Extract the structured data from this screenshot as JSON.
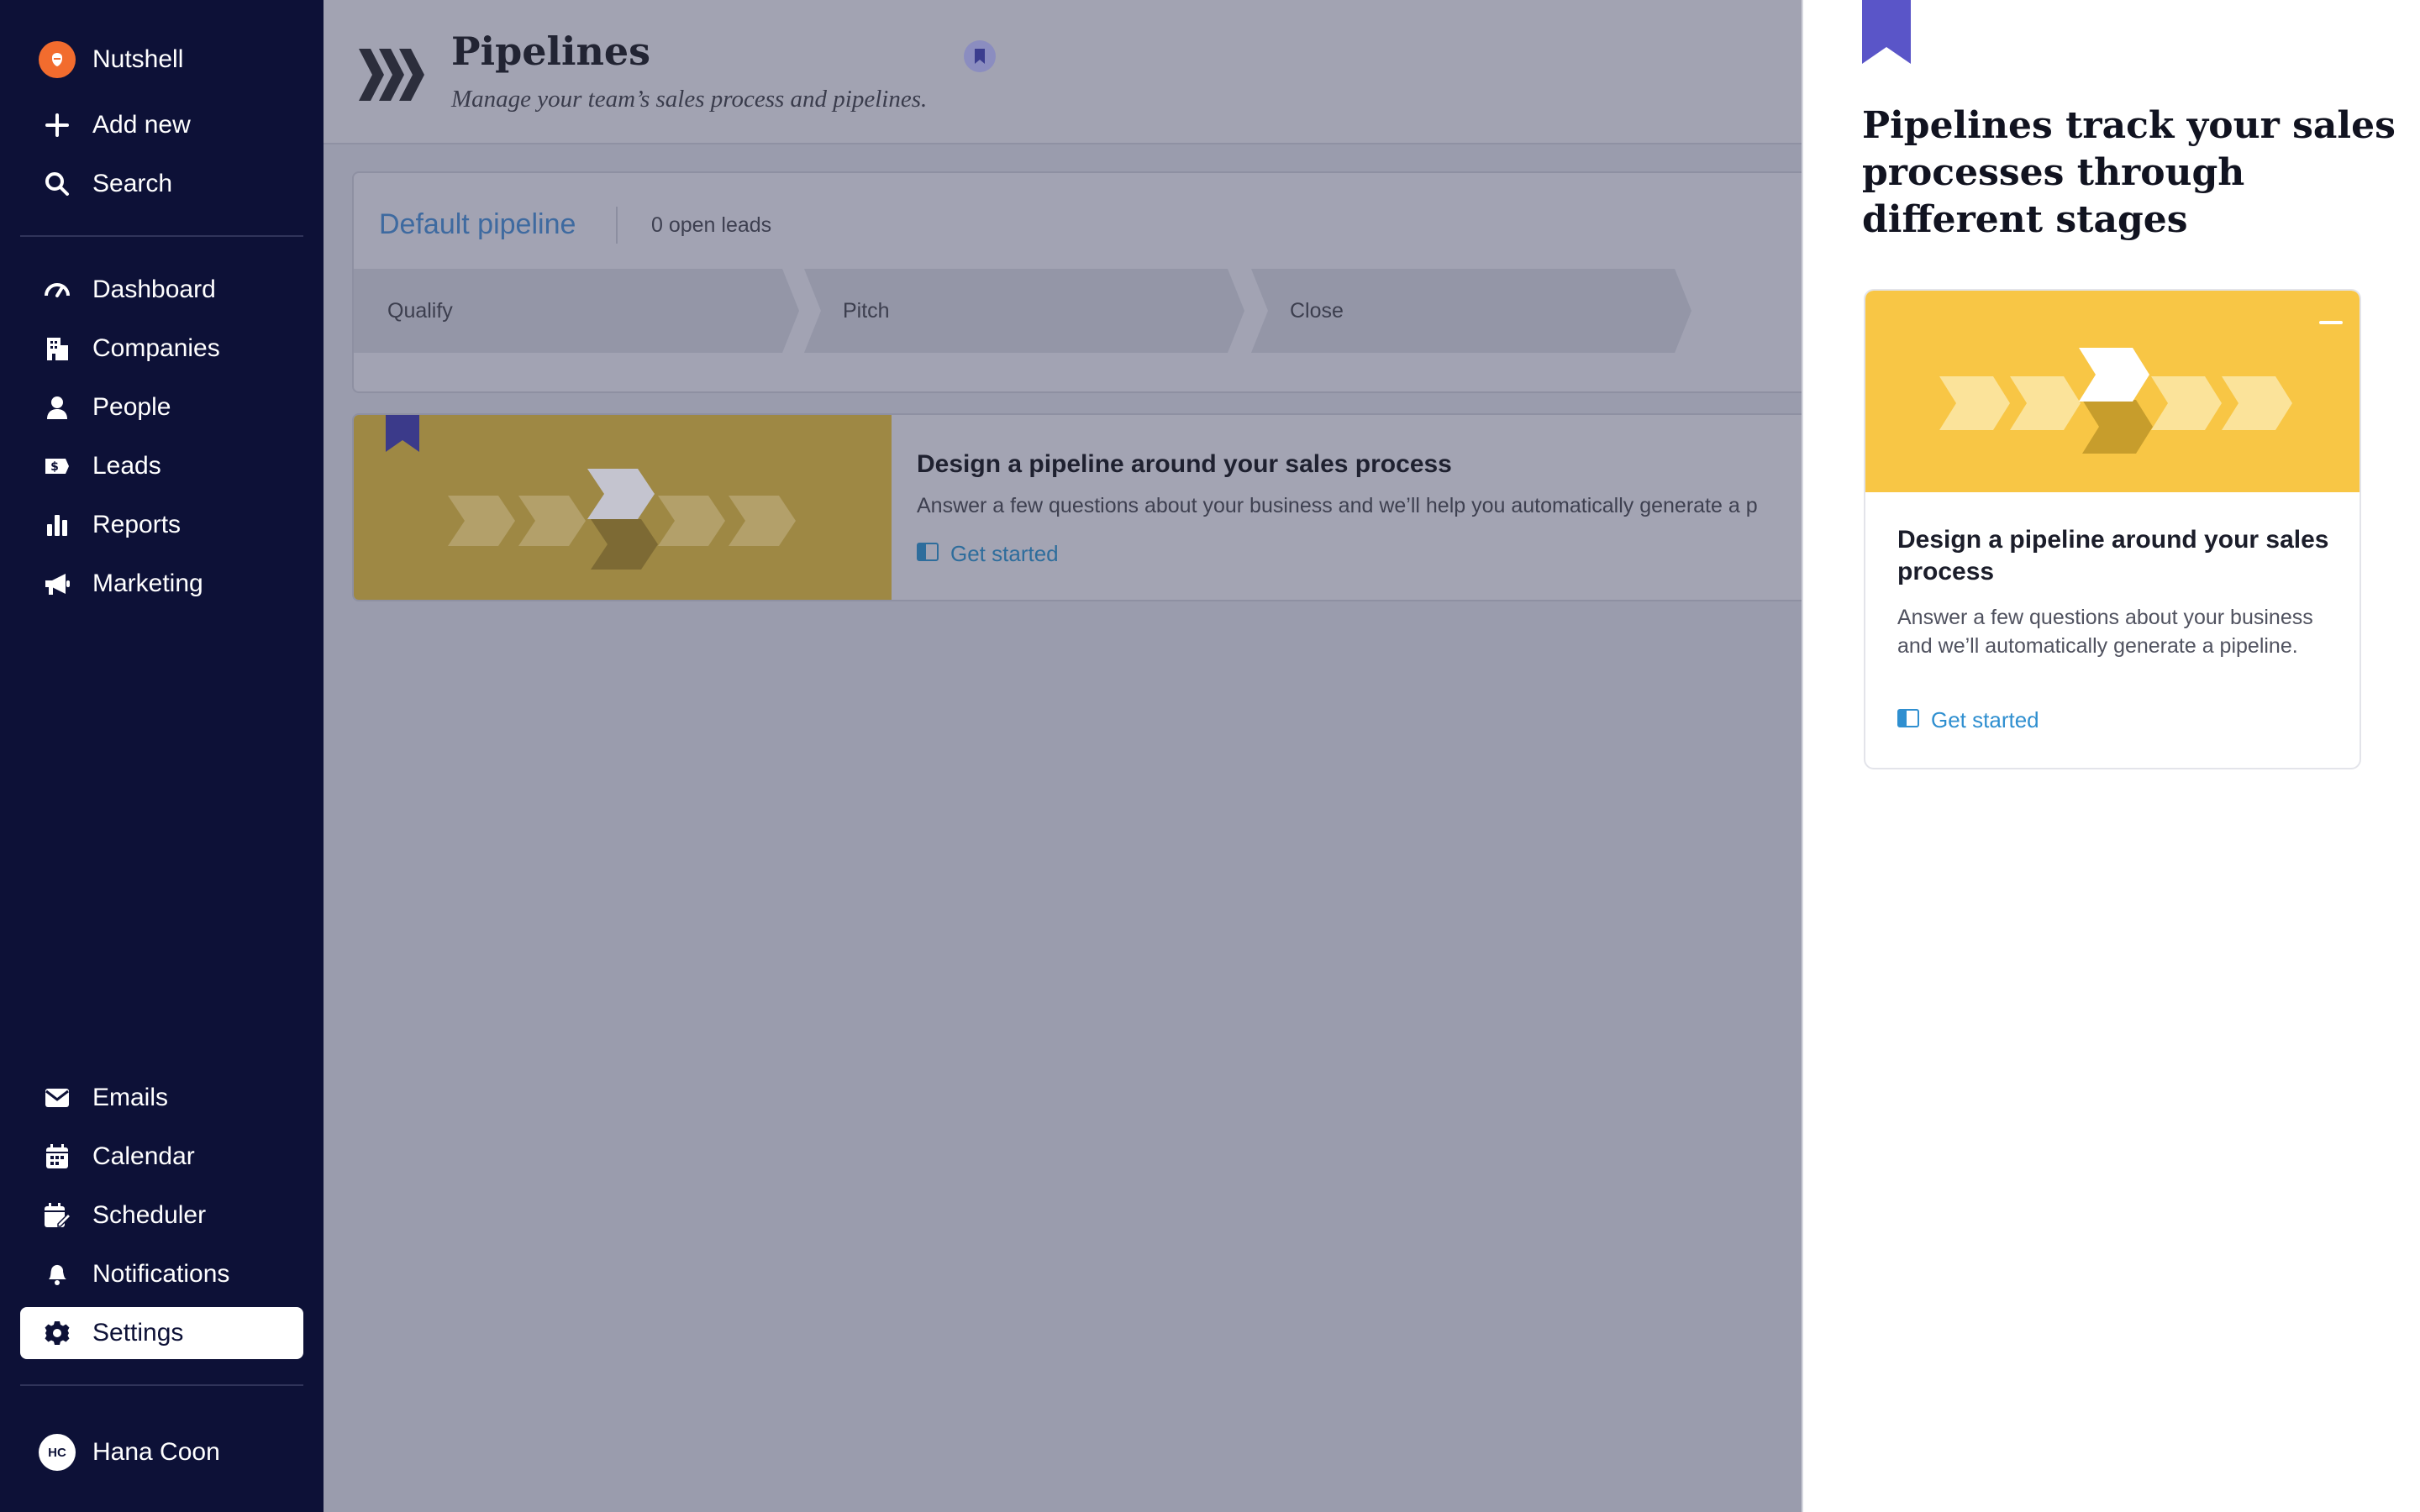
{
  "sidebar": {
    "brand": "Nutshell",
    "top_items": [
      {
        "label": "Add new",
        "icon": "plus-icon"
      },
      {
        "label": "Search",
        "icon": "search-icon"
      }
    ],
    "nav_items": [
      {
        "label": "Dashboard",
        "icon": "gauge-icon"
      },
      {
        "label": "Companies",
        "icon": "building-icon"
      },
      {
        "label": "People",
        "icon": "person-icon"
      },
      {
        "label": "Leads",
        "icon": "money-icon"
      },
      {
        "label": "Reports",
        "icon": "bar-chart-icon"
      },
      {
        "label": "Marketing",
        "icon": "megaphone-icon"
      }
    ],
    "bottom_items": [
      {
        "label": "Emails",
        "icon": "envelope-icon"
      },
      {
        "label": "Calendar",
        "icon": "calendar-icon"
      },
      {
        "label": "Scheduler",
        "icon": "calendar-edit-icon"
      },
      {
        "label": "Notifications",
        "icon": "bell-icon"
      },
      {
        "label": "Settings",
        "icon": "gear-icon",
        "active": true
      }
    ],
    "user": {
      "initials": "HC",
      "name": "Hana Coon"
    }
  },
  "header": {
    "title": "Pipelines",
    "subtitle": "Manage your team’s sales process and pipelines."
  },
  "pipeline": {
    "name": "Default pipeline",
    "open_leads": "0 open leads",
    "stages": [
      "Qualify",
      "Pitch",
      "Close"
    ]
  },
  "promo": {
    "title": "Design a pipeline around your sales process",
    "description": "Answer a few questions about your business and we’ll help you automatically generate a p",
    "link": "Get started"
  },
  "panel": {
    "heading": "Pipelines track your sales processes through different stages",
    "card_title": "Design a pipeline around your sales process",
    "card_description": "Answer a few questions about your business and we’ll automatically generate a pipeline.",
    "card_link": "Get started"
  },
  "colors": {
    "sidebar_bg": "#0d1137",
    "accent_link": "#2f8fd0",
    "brand_orange": "#f26c2e",
    "ribbon": "#5a55c8",
    "promo_yellow": "#f8c645"
  }
}
